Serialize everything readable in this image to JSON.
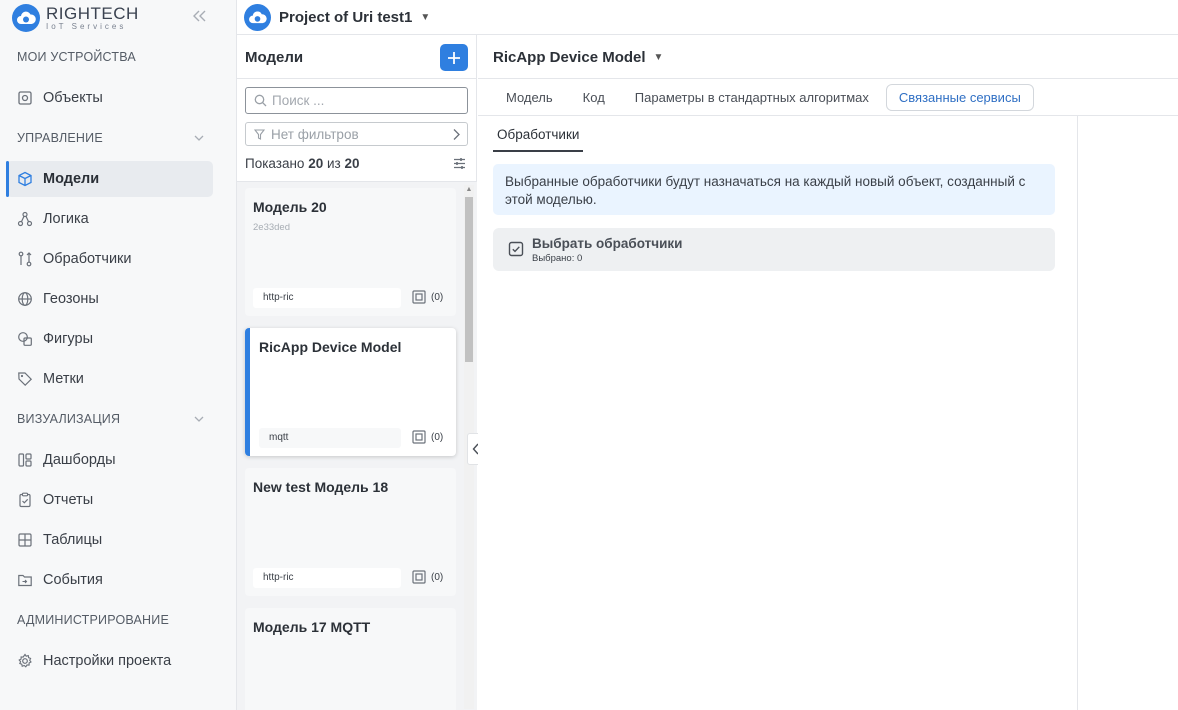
{
  "brand": {
    "title": "RIGHTECH",
    "subtitle": "IoT Services"
  },
  "sidebar": {
    "sections": {
      "devices": "МОИ УСТРОЙСТВА",
      "management": "УПРАВЛЕНИЕ",
      "visualization": "ВИЗУАЛИЗАЦИЯ",
      "administration": "АДМИНИСТРИРОВАНИЕ"
    },
    "items": {
      "objects": "Объекты",
      "models": "Модели",
      "logic": "Логика",
      "handlers": "Обработчики",
      "geozones": "Геозоны",
      "figures": "Фигуры",
      "tags": "Метки",
      "dashboards": "Дашборды",
      "reports": "Отчеты",
      "tables": "Таблицы",
      "events": "События",
      "project_settings": "Настройки проекта"
    },
    "active_item": "models"
  },
  "header": {
    "project_title": "Project of Uri test1"
  },
  "models_panel": {
    "title": "Модели",
    "search_placeholder": "Поиск ...",
    "filter_label": "Нет фильтров",
    "shown_prefix": "Показано",
    "shown_count": "20",
    "shown_mid": "из",
    "shown_total": "20",
    "cards": [
      {
        "title": "Модель 20",
        "id": "2e33ded",
        "protocol": "http-ric",
        "count": "(0)"
      },
      {
        "title": "RicApp Device Model",
        "id": "",
        "protocol": "mqtt",
        "count": "(0)",
        "selected": true
      },
      {
        "title": "New test Модель 18",
        "id": "",
        "protocol": "http-ric",
        "count": "(0)"
      },
      {
        "title": "Модель 17 MQTT",
        "id": "",
        "protocol": "",
        "count": ""
      }
    ]
  },
  "detail": {
    "title": "RicApp Device Model",
    "tabs": [
      "Модель",
      "Код",
      "Параметры в стандартных алгоритмах",
      "Связанные сервисы"
    ],
    "active_tab": "Связанные сервисы",
    "subtab": "Обработчики",
    "info_text": "Выбранные обработчики будут назначаться на каждый новый объект, созданный с этой моделью.",
    "select_title": "Выбрать обработчики",
    "select_subtitle": "Выбрано: 0"
  },
  "colors": {
    "accent": "#2f7fe0",
    "info_bg": "#eaf4ff",
    "active_tab_text": "#2f6fc4"
  }
}
